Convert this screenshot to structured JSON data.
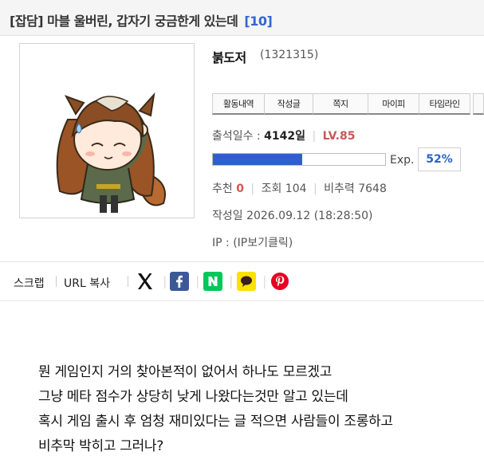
{
  "post": {
    "category": "[잡담]",
    "title": "마블 울버린, 갑자기 궁금한게 있는데",
    "comment_count": "[10]"
  },
  "author": {
    "nickname": "붉도저",
    "id": "(1321315)"
  },
  "tabs": [
    "활동내역",
    "작성글",
    "쪽지",
    "마이피",
    "타임라인"
  ],
  "attendance": {
    "label": "출석일수 :",
    "days": "4142일",
    "level": "LV.85"
  },
  "exp": {
    "label": "Exp.",
    "percent_text": "52%",
    "fraction": 0.52
  },
  "stats": {
    "recommend_label": "추천",
    "recommend_value": "0",
    "views": "조회 104",
    "criticism": "비추력 7648"
  },
  "written_date": "작성일 2026.09.12 (18:28:50)",
  "ip": "IP : (IP보기클릭)",
  "share": {
    "scrap": "스크랩",
    "url_copy": "URL 복사"
  },
  "body_lines": [
    "뭔 게임인지 거의 찾아본적이 없어서 하나도 모르겠고",
    "그냥 메타 점수가 상당히 낮게 나왔다는것만 알고 있는데",
    "혹시 게임 출시 후 엄청 재미있다는 글 적으면 사람들이 조롱하고",
    "비추막 박히고 그러나?"
  ],
  "colors": {
    "accent_blue": "#2f5fcc",
    "level_red": "#c8585a",
    "recommend_red": "#d9534f",
    "facebook": "#3b5998",
    "naver": "#03c75a",
    "kakao": "#fae100",
    "pinterest": "#e60023"
  },
  "icons": [
    "x-twitter-icon",
    "facebook-icon",
    "naver-icon",
    "kakao-story-icon",
    "pinterest-icon"
  ]
}
